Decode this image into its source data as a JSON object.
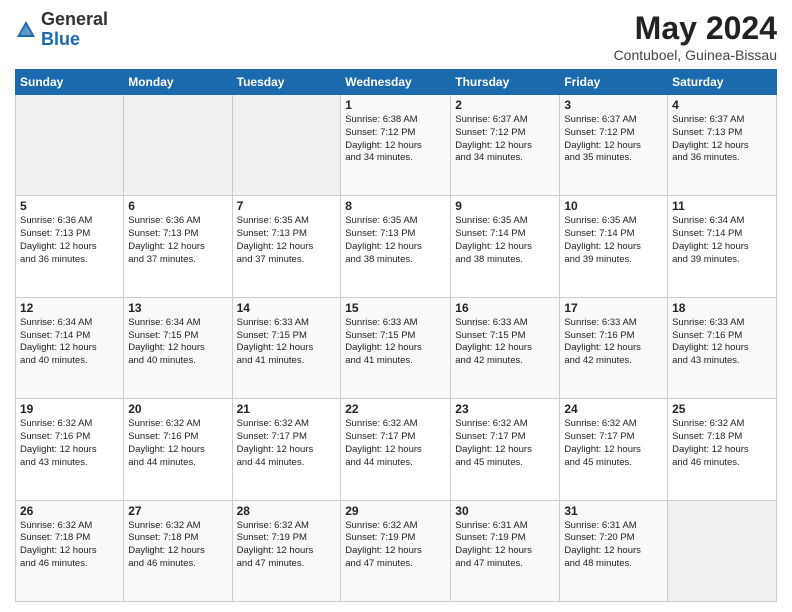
{
  "logo": {
    "general": "General",
    "blue": "Blue"
  },
  "title": {
    "month_year": "May 2024",
    "location": "Contuboel, Guinea-Bissau"
  },
  "weekdays": [
    "Sunday",
    "Monday",
    "Tuesday",
    "Wednesday",
    "Thursday",
    "Friday",
    "Saturday"
  ],
  "weeks": [
    [
      {
        "day": "",
        "info": ""
      },
      {
        "day": "",
        "info": ""
      },
      {
        "day": "",
        "info": ""
      },
      {
        "day": "1",
        "info": "Sunrise: 6:38 AM\nSunset: 7:12 PM\nDaylight: 12 hours\nand 34 minutes."
      },
      {
        "day": "2",
        "info": "Sunrise: 6:37 AM\nSunset: 7:12 PM\nDaylight: 12 hours\nand 34 minutes."
      },
      {
        "day": "3",
        "info": "Sunrise: 6:37 AM\nSunset: 7:12 PM\nDaylight: 12 hours\nand 35 minutes."
      },
      {
        "day": "4",
        "info": "Sunrise: 6:37 AM\nSunset: 7:13 PM\nDaylight: 12 hours\nand 36 minutes."
      }
    ],
    [
      {
        "day": "5",
        "info": "Sunrise: 6:36 AM\nSunset: 7:13 PM\nDaylight: 12 hours\nand 36 minutes."
      },
      {
        "day": "6",
        "info": "Sunrise: 6:36 AM\nSunset: 7:13 PM\nDaylight: 12 hours\nand 37 minutes."
      },
      {
        "day": "7",
        "info": "Sunrise: 6:35 AM\nSunset: 7:13 PM\nDaylight: 12 hours\nand 37 minutes."
      },
      {
        "day": "8",
        "info": "Sunrise: 6:35 AM\nSunset: 7:13 PM\nDaylight: 12 hours\nand 38 minutes."
      },
      {
        "day": "9",
        "info": "Sunrise: 6:35 AM\nSunset: 7:14 PM\nDaylight: 12 hours\nand 38 minutes."
      },
      {
        "day": "10",
        "info": "Sunrise: 6:35 AM\nSunset: 7:14 PM\nDaylight: 12 hours\nand 39 minutes."
      },
      {
        "day": "11",
        "info": "Sunrise: 6:34 AM\nSunset: 7:14 PM\nDaylight: 12 hours\nand 39 minutes."
      }
    ],
    [
      {
        "day": "12",
        "info": "Sunrise: 6:34 AM\nSunset: 7:14 PM\nDaylight: 12 hours\nand 40 minutes."
      },
      {
        "day": "13",
        "info": "Sunrise: 6:34 AM\nSunset: 7:15 PM\nDaylight: 12 hours\nand 40 minutes."
      },
      {
        "day": "14",
        "info": "Sunrise: 6:33 AM\nSunset: 7:15 PM\nDaylight: 12 hours\nand 41 minutes."
      },
      {
        "day": "15",
        "info": "Sunrise: 6:33 AM\nSunset: 7:15 PM\nDaylight: 12 hours\nand 41 minutes."
      },
      {
        "day": "16",
        "info": "Sunrise: 6:33 AM\nSunset: 7:15 PM\nDaylight: 12 hours\nand 42 minutes."
      },
      {
        "day": "17",
        "info": "Sunrise: 6:33 AM\nSunset: 7:16 PM\nDaylight: 12 hours\nand 42 minutes."
      },
      {
        "day": "18",
        "info": "Sunrise: 6:33 AM\nSunset: 7:16 PM\nDaylight: 12 hours\nand 43 minutes."
      }
    ],
    [
      {
        "day": "19",
        "info": "Sunrise: 6:32 AM\nSunset: 7:16 PM\nDaylight: 12 hours\nand 43 minutes."
      },
      {
        "day": "20",
        "info": "Sunrise: 6:32 AM\nSunset: 7:16 PM\nDaylight: 12 hours\nand 44 minutes."
      },
      {
        "day": "21",
        "info": "Sunrise: 6:32 AM\nSunset: 7:17 PM\nDaylight: 12 hours\nand 44 minutes."
      },
      {
        "day": "22",
        "info": "Sunrise: 6:32 AM\nSunset: 7:17 PM\nDaylight: 12 hours\nand 44 minutes."
      },
      {
        "day": "23",
        "info": "Sunrise: 6:32 AM\nSunset: 7:17 PM\nDaylight: 12 hours\nand 45 minutes."
      },
      {
        "day": "24",
        "info": "Sunrise: 6:32 AM\nSunset: 7:17 PM\nDaylight: 12 hours\nand 45 minutes."
      },
      {
        "day": "25",
        "info": "Sunrise: 6:32 AM\nSunset: 7:18 PM\nDaylight: 12 hours\nand 46 minutes."
      }
    ],
    [
      {
        "day": "26",
        "info": "Sunrise: 6:32 AM\nSunset: 7:18 PM\nDaylight: 12 hours\nand 46 minutes."
      },
      {
        "day": "27",
        "info": "Sunrise: 6:32 AM\nSunset: 7:18 PM\nDaylight: 12 hours\nand 46 minutes."
      },
      {
        "day": "28",
        "info": "Sunrise: 6:32 AM\nSunset: 7:19 PM\nDaylight: 12 hours\nand 47 minutes."
      },
      {
        "day": "29",
        "info": "Sunrise: 6:32 AM\nSunset: 7:19 PM\nDaylight: 12 hours\nand 47 minutes."
      },
      {
        "day": "30",
        "info": "Sunrise: 6:31 AM\nSunset: 7:19 PM\nDaylight: 12 hours\nand 47 minutes."
      },
      {
        "day": "31",
        "info": "Sunrise: 6:31 AM\nSunset: 7:20 PM\nDaylight: 12 hours\nand 48 minutes."
      },
      {
        "day": "",
        "info": ""
      }
    ]
  ]
}
